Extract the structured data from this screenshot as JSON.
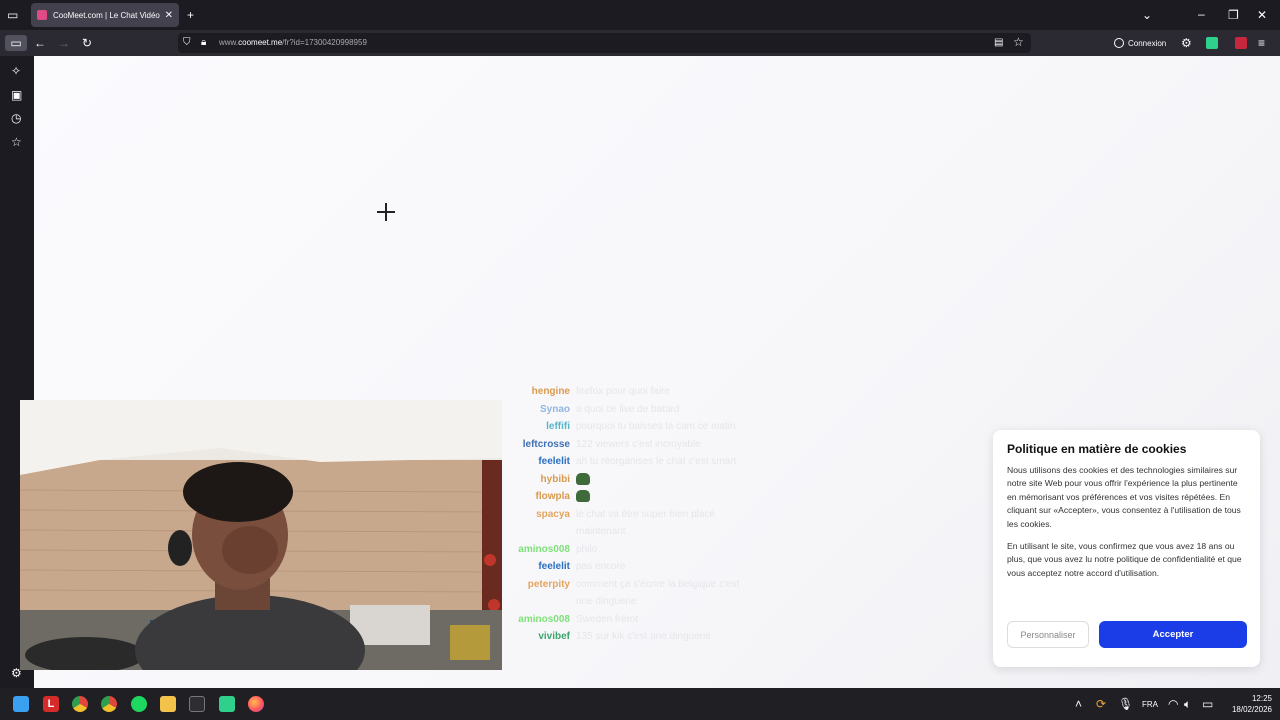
{
  "browser": {
    "tab_title": "CooMeet.com | Le Chat Vidéo A",
    "url_prefix": "www.",
    "url_domain": "coomeet.me",
    "url_rest": "/fr?id=17300420998959",
    "connexion_label": "Connexion"
  },
  "chat": [
    {
      "user": "hengine",
      "color": "#d99a4e",
      "text": "firefox pour quoi faire"
    },
    {
      "user": "Synao",
      "color": "#8fb6e0",
      "text": "a quoi ce live de batard"
    },
    {
      "user": "leffifi",
      "color": "#58b4c9",
      "text": "pourquoi tu baisses la cam ce matin"
    },
    {
      "user": "leftcrosse",
      "color": "#3f6fb4",
      "text": "122 viewers c'est incroyable"
    },
    {
      "user": "feelelit",
      "color": "#2c6fc1",
      "text": "ah tu réorganises le chat c'est smart"
    },
    {
      "user": "hybibi",
      "color": "#d99a4e",
      "text": "",
      "emote": true
    },
    {
      "user": "flowpla",
      "color": "#d99a4e",
      "text": "",
      "emote": true
    },
    {
      "user": "spacya",
      "color": "#e3a560",
      "text": "le chat va être super bien placé maintenant"
    },
    {
      "user": "aminos008",
      "color": "#7fe07a",
      "text": "philo"
    },
    {
      "user": "feelelit",
      "color": "#2c6fc1",
      "text": "pas encore"
    },
    {
      "user": "peterpity",
      "color": "#e3a560",
      "text": "comment ça s'écrire la belgique c'est une dinguerie"
    },
    {
      "user": "aminos008",
      "color": "#7fe07a",
      "text": "Sweden frérot"
    },
    {
      "user": "vivibef",
      "color": "#3aa56c",
      "text": "135 sur kik c'est une dinguerie"
    }
  ],
  "cookie": {
    "title": "Politique en matière de cookies",
    "para1": "Nous utilisons des cookies et des technologies similaires sur notre site Web pour vous offrir l'expérience la plus pertinente en mémorisant vos préférences et vos visites répétées. En cliquant sur «Accepter», vous consentez à l'utilisation de tous les cookies.",
    "para2": "En utilisant le site, vous confirmez que vous avez 18 ans ou plus, que vous avez lu notre politique de confidentialité et que vous acceptez notre accord d'utilisation.",
    "customize_label": "Personnaliser",
    "accept_label": "Accepter"
  },
  "taskbar": {
    "lang": "FRA",
    "time": "12:25",
    "date": "18/02/2026"
  }
}
